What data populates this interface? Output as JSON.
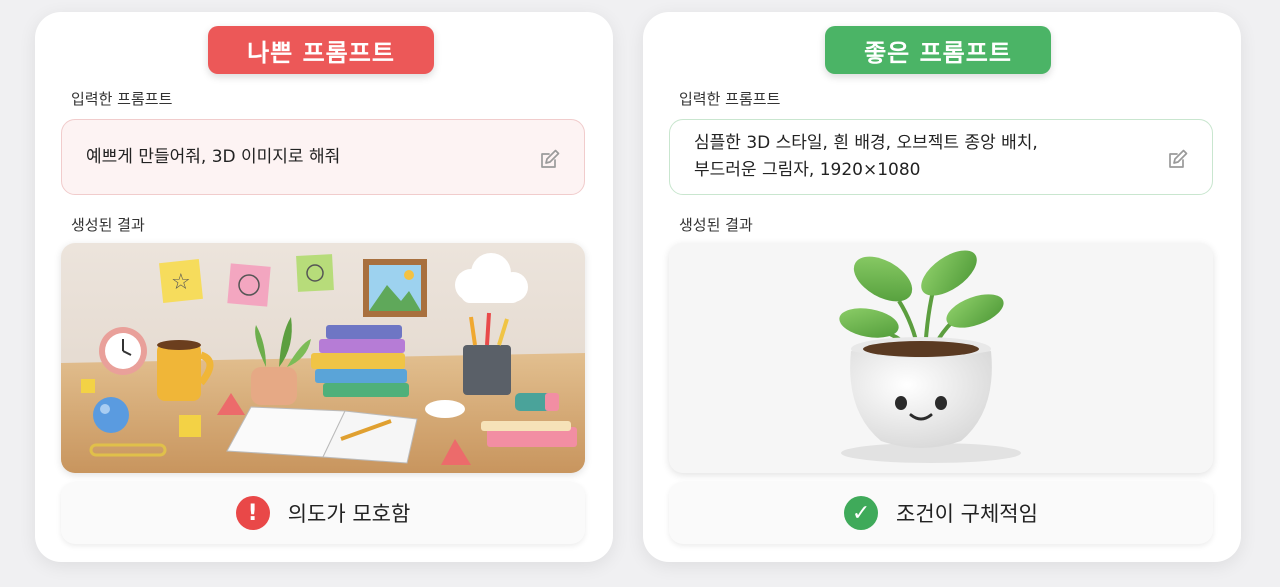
{
  "bad": {
    "badge": "나쁜 프롬프트",
    "input_label": "입력한 프롬프트",
    "prompt": "예쁘게 만들어줘, 3D 이미지로 해줘",
    "result_label": "생성된 결과",
    "image_icon": "cluttered-desk-illustration",
    "verdict_icon": "exclamation-icon",
    "verdict": "의도가 모호함",
    "accent_color": "#ec5858"
  },
  "good": {
    "badge": "좋은 프롬프트",
    "input_label": "입력한 프롬프트",
    "prompt": "심플한 3D 스타일, 흰 배경, 오브젝트 종앙 배치,\n부드러운 그림자, 1920×1080",
    "result_label": "생성된 결과",
    "image_icon": "potted-plant-illustration",
    "verdict_icon": "check-icon",
    "verdict": "조건이 구체적임",
    "accent_color": "#4bb466"
  }
}
